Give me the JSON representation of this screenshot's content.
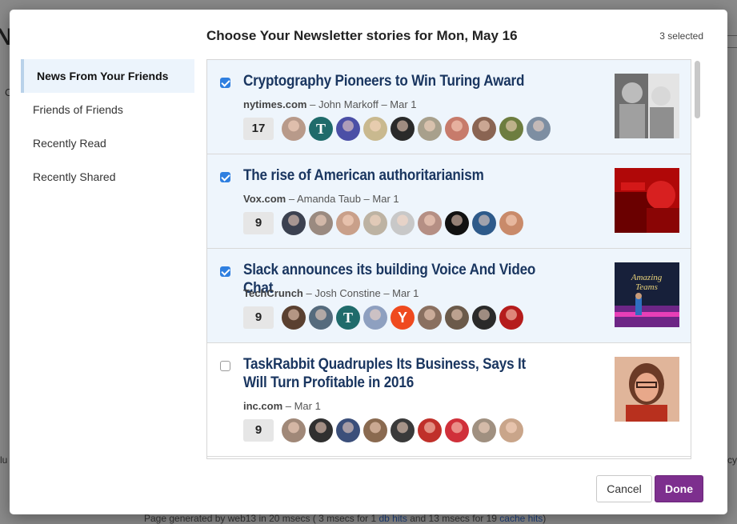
{
  "background": {
    "left_fragment": "N",
    "left_c_fragment": "C",
    "left_u_fragment": "lu",
    "right_fragment": "cy",
    "footer": {
      "prefix": "Page generated by web13 in 20 msecs ( 3 msecs for 1 ",
      "link1": "db hits",
      "middle": " and 13 msecs for 19 ",
      "link2": "cache hits",
      "suffix": ")"
    }
  },
  "modal": {
    "title": "Choose Your Newsletter stories for Mon, May 16",
    "selected_count": "3 selected",
    "cancel_label": "Cancel",
    "done_label": "Done"
  },
  "sidebar": {
    "items": [
      {
        "label": "News From Your Friends",
        "active": true
      },
      {
        "label": "Friends of Friends",
        "active": false
      },
      {
        "label": "Recently Read",
        "active": false
      },
      {
        "label": "Recently Shared",
        "active": false
      }
    ]
  },
  "stories": [
    {
      "title": "Cryptography Pioneers to Win Turing Award",
      "source": "nytimes.com",
      "author_date": " – John Markoff – Mar 1",
      "count": "17",
      "selected": true,
      "avatars": [
        "#b89a8a",
        "#1f6b6b",
        "#4b4fa6",
        "#c9b98f",
        "#2a2a2a",
        "#a8a08c",
        "#c77b6b",
        "#8a6452",
        "#6d7d3f",
        "#7d8ea2"
      ],
      "thumb_colors": [
        "#777",
        "#ddd"
      ]
    },
    {
      "title": "The rise of American authoritarianism",
      "source": "Vox.com",
      "author_date": " – Amanda Taub – Mar 1",
      "count": "9",
      "selected": true,
      "avatars": [
        "#3b4150",
        "#9a8a80",
        "#c9a08a",
        "#bdb3a3",
        "#c8c8c8",
        "#b58f84",
        "#111111",
        "#2e5a8a",
        "#c98a6a"
      ],
      "thumb_colors": [
        "#c01010",
        "#6b0000"
      ]
    },
    {
      "title": "Slack announces its building Voice And Video Chat",
      "source": "TechCrunch",
      "author_date": " – Josh Constine – Mar 1",
      "count": "9",
      "selected": true,
      "avatars": [
        "#5a4030",
        "#556b7d",
        "#1f6b6b",
        "#8ea0c0",
        "#ef4a1f",
        "#8a7060",
        "#6b5a4a",
        "#2a2a2a",
        "#b51c1c"
      ],
      "thumb_colors": [
        "#1a2440",
        "#7b2c8e"
      ]
    },
    {
      "title": "TaskRabbit Quadruples Its Business, Says It Will Turn Profitable in 2016",
      "source": "inc.com",
      "author_date": " – Mar 1",
      "count": "9",
      "selected": false,
      "avatars": [
        "#a08878",
        "#303030",
        "#3b4f7a",
        "#8a6a50",
        "#3a3a3a",
        "#c0302a",
        "#d0303a",
        "#a09080",
        "#c9a58a"
      ],
      "thumb_colors": [
        "#d98a70",
        "#8a2e1e"
      ]
    }
  ]
}
